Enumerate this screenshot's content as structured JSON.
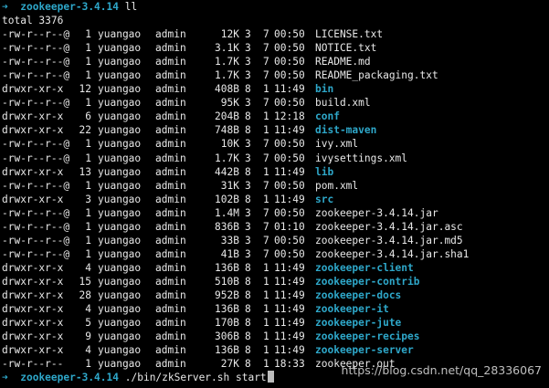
{
  "prompt": {
    "icon": "➜",
    "path": "zookeeper-3.4.14",
    "first_command": " ll",
    "last_command": " ./bin/zkServer.sh start"
  },
  "total_line": "total 3376",
  "colors": {
    "background": "#000000",
    "text": "#e8e8e8",
    "directory": "#2ea7c9",
    "prompt": "#2ea7c9"
  },
  "entries": [
    {
      "perm": "-rw-r--r--@",
      "links": "1",
      "user": "yuangao",
      "group": "admin",
      "size": "12K",
      "month": "3",
      "day": "7",
      "time": "00:50",
      "name": "LICENSE.txt",
      "is_dir": false
    },
    {
      "perm": "-rw-r--r--@",
      "links": "1",
      "user": "yuangao",
      "group": "admin",
      "size": "3.1K",
      "month": "3",
      "day": "7",
      "time": "00:50",
      "name": "NOTICE.txt",
      "is_dir": false
    },
    {
      "perm": "-rw-r--r--@",
      "links": "1",
      "user": "yuangao",
      "group": "admin",
      "size": "1.7K",
      "month": "3",
      "day": "7",
      "time": "00:50",
      "name": "README.md",
      "is_dir": false
    },
    {
      "perm": "-rw-r--r--@",
      "links": "1",
      "user": "yuangao",
      "group": "admin",
      "size": "1.7K",
      "month": "3",
      "day": "7",
      "time": "00:50",
      "name": "README_packaging.txt",
      "is_dir": false
    },
    {
      "perm": "drwxr-xr-x",
      "links": "12",
      "user": "yuangao",
      "group": "admin",
      "size": "408B",
      "month": "8",
      "day": "1",
      "time": "11:49",
      "name": "bin",
      "is_dir": true
    },
    {
      "perm": "-rw-r--r--@",
      "links": "1",
      "user": "yuangao",
      "group": "admin",
      "size": "95K",
      "month": "3",
      "day": "7",
      "time": "00:50",
      "name": "build.xml",
      "is_dir": false
    },
    {
      "perm": "drwxr-xr-x",
      "links": "6",
      "user": "yuangao",
      "group": "admin",
      "size": "204B",
      "month": "8",
      "day": "1",
      "time": "12:18",
      "name": "conf",
      "is_dir": true
    },
    {
      "perm": "drwxr-xr-x",
      "links": "22",
      "user": "yuangao",
      "group": "admin",
      "size": "748B",
      "month": "8",
      "day": "1",
      "time": "11:49",
      "name": "dist-maven",
      "is_dir": true
    },
    {
      "perm": "-rw-r--r--@",
      "links": "1",
      "user": "yuangao",
      "group": "admin",
      "size": "10K",
      "month": "3",
      "day": "7",
      "time": "00:50",
      "name": "ivy.xml",
      "is_dir": false
    },
    {
      "perm": "-rw-r--r--@",
      "links": "1",
      "user": "yuangao",
      "group": "admin",
      "size": "1.7K",
      "month": "3",
      "day": "7",
      "time": "00:50",
      "name": "ivysettings.xml",
      "is_dir": false
    },
    {
      "perm": "drwxr-xr-x",
      "links": "13",
      "user": "yuangao",
      "group": "admin",
      "size": "442B",
      "month": "8",
      "day": "1",
      "time": "11:49",
      "name": "lib",
      "is_dir": true
    },
    {
      "perm": "-rw-r--r--@",
      "links": "1",
      "user": "yuangao",
      "group": "admin",
      "size": "31K",
      "month": "3",
      "day": "7",
      "time": "00:50",
      "name": "pom.xml",
      "is_dir": false
    },
    {
      "perm": "drwxr-xr-x",
      "links": "3",
      "user": "yuangao",
      "group": "admin",
      "size": "102B",
      "month": "8",
      "day": "1",
      "time": "11:49",
      "name": "src",
      "is_dir": true
    },
    {
      "perm": "-rw-r--r--@",
      "links": "1",
      "user": "yuangao",
      "group": "admin",
      "size": "1.4M",
      "month": "3",
      "day": "7",
      "time": "00:50",
      "name": "zookeeper-3.4.14.jar",
      "is_dir": false
    },
    {
      "perm": "-rw-r--r--@",
      "links": "1",
      "user": "yuangao",
      "group": "admin",
      "size": "836B",
      "month": "3",
      "day": "7",
      "time": "01:10",
      "name": "zookeeper-3.4.14.jar.asc",
      "is_dir": false
    },
    {
      "perm": "-rw-r--r--@",
      "links": "1",
      "user": "yuangao",
      "group": "admin",
      "size": "33B",
      "month": "3",
      "day": "7",
      "time": "00:50",
      "name": "zookeeper-3.4.14.jar.md5",
      "is_dir": false
    },
    {
      "perm": "-rw-r--r--@",
      "links": "1",
      "user": "yuangao",
      "group": "admin",
      "size": "41B",
      "month": "3",
      "day": "7",
      "time": "00:50",
      "name": "zookeeper-3.4.14.jar.sha1",
      "is_dir": false
    },
    {
      "perm": "drwxr-xr-x",
      "links": "4",
      "user": "yuangao",
      "group": "admin",
      "size": "136B",
      "month": "8",
      "day": "1",
      "time": "11:49",
      "name": "zookeeper-client",
      "is_dir": true
    },
    {
      "perm": "drwxr-xr-x",
      "links": "15",
      "user": "yuangao",
      "group": "admin",
      "size": "510B",
      "month": "8",
      "day": "1",
      "time": "11:49",
      "name": "zookeeper-contrib",
      "is_dir": true
    },
    {
      "perm": "drwxr-xr-x",
      "links": "28",
      "user": "yuangao",
      "group": "admin",
      "size": "952B",
      "month": "8",
      "day": "1",
      "time": "11:49",
      "name": "zookeeper-docs",
      "is_dir": true
    },
    {
      "perm": "drwxr-xr-x",
      "links": "4",
      "user": "yuangao",
      "group": "admin",
      "size": "136B",
      "month": "8",
      "day": "1",
      "time": "11:49",
      "name": "zookeeper-it",
      "is_dir": true
    },
    {
      "perm": "drwxr-xr-x",
      "links": "5",
      "user": "yuangao",
      "group": "admin",
      "size": "170B",
      "month": "8",
      "day": "1",
      "time": "11:49",
      "name": "zookeeper-jute",
      "is_dir": true
    },
    {
      "perm": "drwxr-xr-x",
      "links": "9",
      "user": "yuangao",
      "group": "admin",
      "size": "306B",
      "month": "8",
      "day": "1",
      "time": "11:49",
      "name": "zookeeper-recipes",
      "is_dir": true
    },
    {
      "perm": "drwxr-xr-x",
      "links": "4",
      "user": "yuangao",
      "group": "admin",
      "size": "136B",
      "month": "8",
      "day": "1",
      "time": "11:49",
      "name": "zookeeper-server",
      "is_dir": true
    },
    {
      "perm": "-rw-r--r--",
      "links": "1",
      "user": "yuangao",
      "group": "admin",
      "size": "27K",
      "month": "8",
      "day": "1",
      "time": "18:33",
      "name": "zookeeper.out",
      "is_dir": false
    }
  ],
  "watermark": "https://blog.csdn.net/qq_28336067"
}
